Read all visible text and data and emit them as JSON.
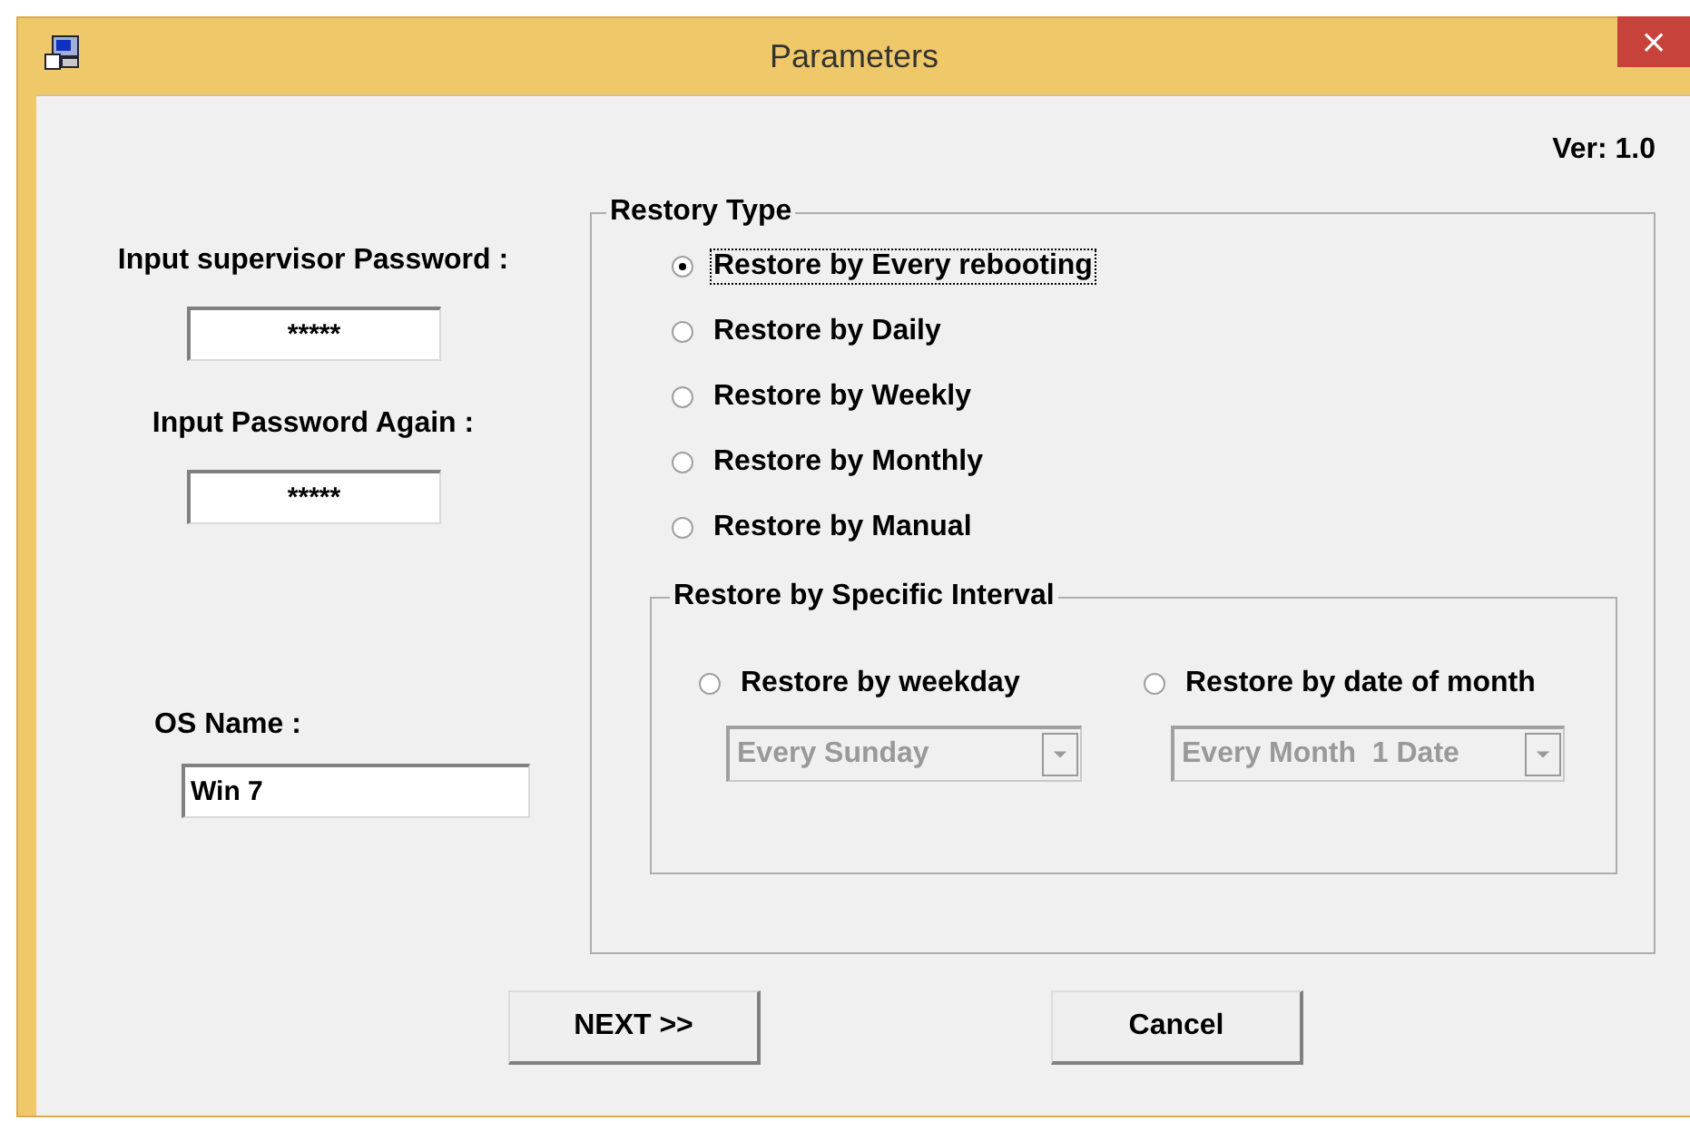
{
  "window": {
    "title": "Parameters",
    "close": "×"
  },
  "version": "Ver: 1.0",
  "supervisor_password": {
    "label": "Input supervisor Password :",
    "value": "*****"
  },
  "password_again": {
    "label": "Input Password Again :",
    "value": "*****"
  },
  "os_name": {
    "label": "OS Name :",
    "value": "Win 7"
  },
  "restory_type": {
    "title": "Restory Type",
    "options": [
      {
        "label": "Restore by Every rebooting",
        "selected": true,
        "focused": true
      },
      {
        "label": "Restore by Daily",
        "selected": false,
        "focused": false
      },
      {
        "label": "Restore by Weekly",
        "selected": false,
        "focused": false
      },
      {
        "label": "Restore by Monthly",
        "selected": false,
        "focused": false
      },
      {
        "label": "Restore by Manual",
        "selected": false,
        "focused": false
      }
    ]
  },
  "specific_interval": {
    "title": "Restore by Specific Interval",
    "options": [
      {
        "label": "Restore by weekday",
        "selected": false,
        "combo": {
          "value": "Every Sunday",
          "disabled": true
        }
      },
      {
        "label": "Restore by date of month",
        "selected": false,
        "combo": {
          "value": "Every Month  1 Date",
          "disabled": true
        }
      }
    ]
  },
  "buttons": [
    "NEXT >>",
    "Cancel"
  ]
}
